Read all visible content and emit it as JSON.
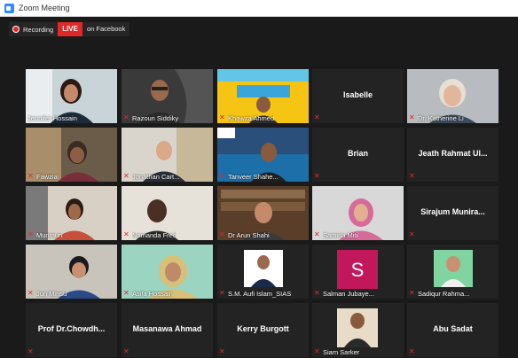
{
  "window": {
    "title": "Zoom Meeting"
  },
  "broadcast": {
    "recording_label": "Recording",
    "live_label": "LIVE",
    "platform_label": "on Facebook"
  },
  "participants": [
    "Jennifer Hossain",
    "Razoun Siddiky",
    "Khawza Ahmed",
    "Isabelle",
    "Dr. Katherine Li",
    "Fawzia",
    "Jonathan Cart...",
    "Tanveer Shahe...",
    "Brian",
    "Jeath Rahmat Ul...",
    "Munmun",
    "Namanda Fred",
    "Dr Arun Shahi",
    "Samina Miti",
    "Sirajum Munira...",
    "Jun Minsu",
    "Asifa Hossain",
    "S.M. Aufi Islam_SIAS",
    "Salman Jubaye...",
    "Sadiqur Rahma...",
    "Prof Dr.Chowdh...",
    "Masanawa Ahmad",
    "Kerry Burgott",
    "Siam Sarker",
    "Abu Sadat"
  ],
  "avatar_letter": "S",
  "colors": {
    "live": "#e02828",
    "active_speaker": "#b5e23a",
    "avatar_bg": "#c2185b",
    "muted_icon": "#e02828"
  }
}
